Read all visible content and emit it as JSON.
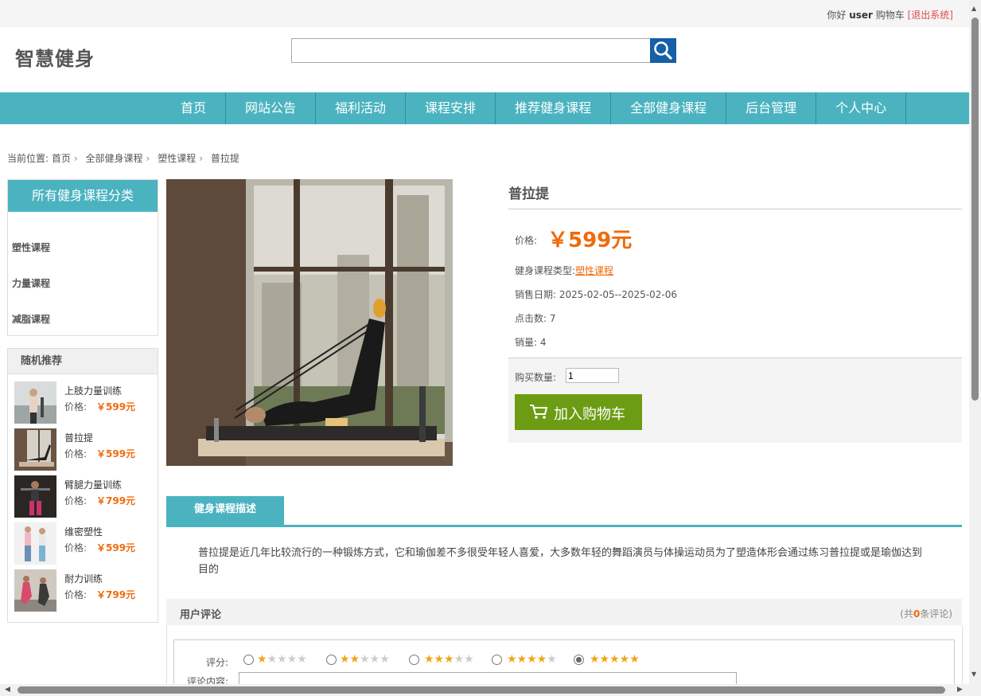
{
  "topbar": {
    "greeting": "你好",
    "user": "user",
    "cart": "购物车",
    "logout": "[退出系统]"
  },
  "header": {
    "logo": "智慧健身",
    "search_placeholder": ""
  },
  "nav": [
    "首页",
    "网站公告",
    "福利活动",
    "课程安排",
    "推荐健身课程",
    "全部健身课程",
    "后台管理",
    "个人中心"
  ],
  "breadcrumb": {
    "prefix": "当前位置:",
    "items": [
      "首页",
      "全部健身课程",
      "塑性课程",
      "普拉提"
    ]
  },
  "categories": {
    "title": "所有健身课程分类",
    "items": [
      "塑性课程",
      "力量课程",
      "减脂课程"
    ]
  },
  "recommend": {
    "title": "随机推荐",
    "price_label": "价格:",
    "items": [
      {
        "name": "上肢力量训练",
        "price": "￥599元"
      },
      {
        "name": "普拉提",
        "price": "￥599元"
      },
      {
        "name": "臂腿力量训练",
        "price": "￥799元"
      },
      {
        "name": "维密塑性",
        "price": "￥599元"
      },
      {
        "name": "耐力训练",
        "price": "￥799元"
      }
    ]
  },
  "product": {
    "title": "普拉提",
    "price_label": "价格:",
    "price": "￥599元",
    "type_label": "健身课程类型:",
    "type_value": "塑性课程",
    "date_label": "销售日期:",
    "date_value": "2025-02-05--2025-02-06",
    "clicks_label": "点击数:",
    "clicks_value": "7",
    "sales_label": "销量:",
    "sales_value": "4",
    "qty_label": "购买数量:",
    "qty_value": "1",
    "add_to_cart": "加入购物车"
  },
  "description": {
    "tab": "健身课程描述",
    "text": "普拉提是近几年比较流行的一种锻炼方式，它和瑜伽差不多很受年轻人喜爱，大多数年轻的舞蹈演员与体操运动员为了塑造体形会通过练习普拉提或是瑜伽达到目的"
  },
  "comments": {
    "title": "用户评论",
    "count_prefix": "(共",
    "count": "0",
    "count_suffix": "条评论)",
    "rating_label": "评分:",
    "content_label": "评论内容:",
    "selected_rating": 5
  },
  "colors": {
    "accent": "#4bb3c0",
    "price": "#f06a0c",
    "cart_button": "#6c9c13",
    "search_button": "#1560a6"
  }
}
